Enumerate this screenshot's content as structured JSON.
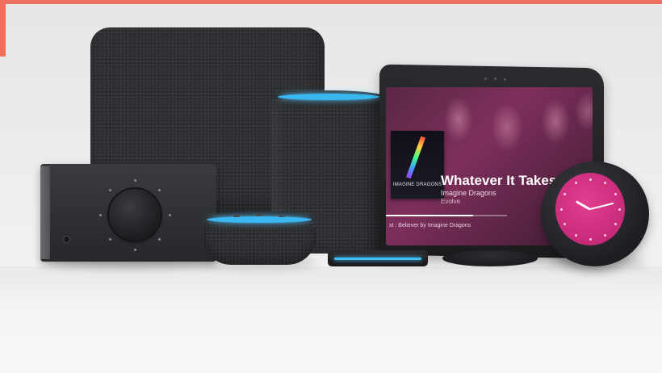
{
  "screen": {
    "track_title": "Whatever It Takes",
    "artist": "Imagine Dragons",
    "album": "Evolve",
    "album_art_text": "IMAGINE DRAGONS",
    "up_next": "xt : Believer by Imagine Dragons",
    "progress": 0.72
  },
  "colors": {
    "accent_ring": "#3cb6f2",
    "screen_bg": "#7d2f5b",
    "clock_face": "#e23e8f",
    "top_bar": "#f07060"
  },
  "icons": {
    "amp_knob": "volume-knob-icon",
    "clock": "clock-icon"
  }
}
